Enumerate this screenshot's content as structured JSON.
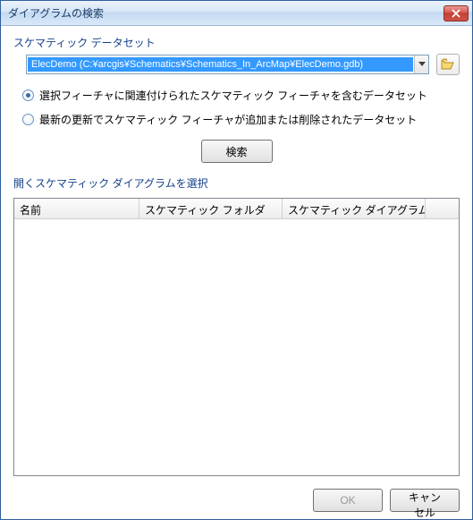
{
  "titlebar": {
    "text": "ダイアグラムの検索"
  },
  "dataset": {
    "label": "スケマティック データセット",
    "value": "ElecDemo (C:¥arcgis¥Schematics¥Schematics_In_ArcMap¥ElecDemo.gdb)"
  },
  "radios": {
    "opt1": "選択フィーチャに関連付けられたスケマティック フィーチャを含むデータセット",
    "opt2": "最新の更新でスケマティック フィーチャが追加または削除されたデータセット",
    "selected": "opt1"
  },
  "buttons": {
    "search": "検索",
    "ok": "OK",
    "cancel": "キャンセル"
  },
  "listview": {
    "label": "開くスケマティック ダイアグラムを選択",
    "columns": {
      "name": "名前",
      "folder": "スケマティック フォルダ",
      "template": "スケマティック ダイアグラム..."
    }
  }
}
